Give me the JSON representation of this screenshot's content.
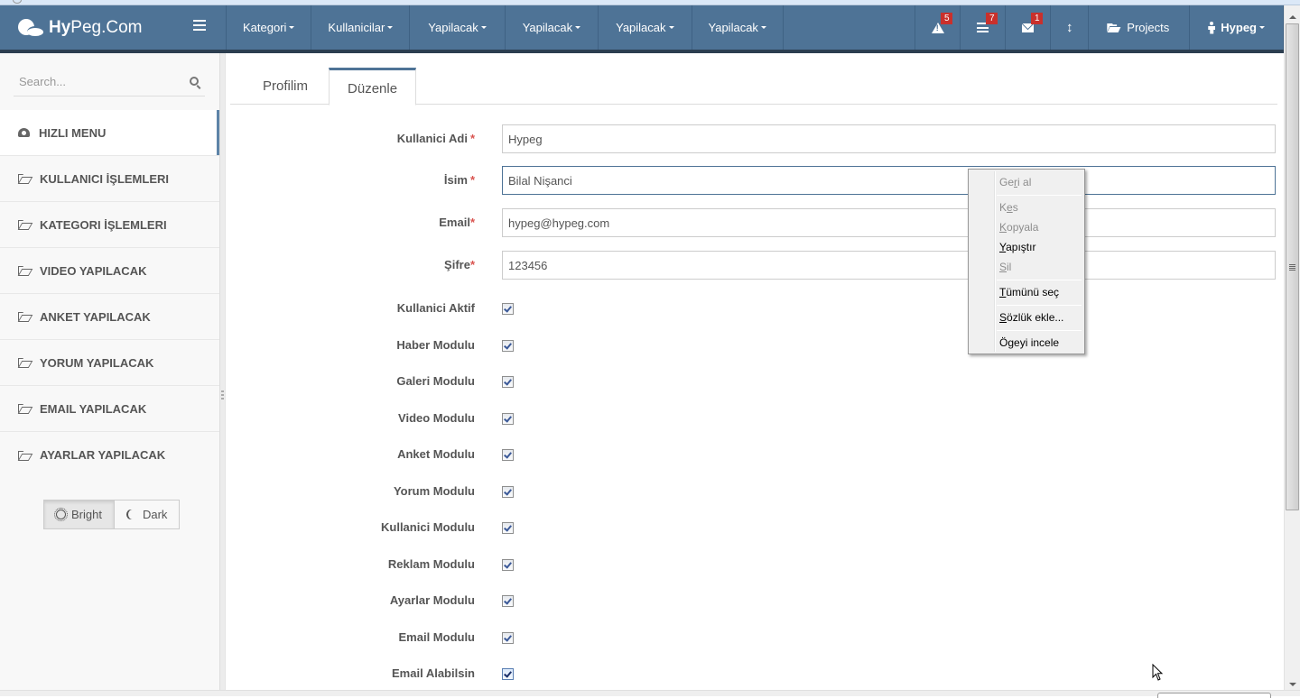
{
  "navbar": {
    "brand_bold": "Hy",
    "brand_rest": "Peg.Com",
    "menus": [
      {
        "label": "Kategori"
      },
      {
        "label": "Kullanicilar"
      },
      {
        "label": "Yapilacak"
      },
      {
        "label": "Yapilacak"
      },
      {
        "label": "Yapilacak"
      },
      {
        "label": "Yapilacak"
      }
    ],
    "alerts_badge": "5",
    "tasks_badge": "7",
    "messages_badge": "1",
    "projects_label": "Projects",
    "user_label": "Hypeg",
    "accent_color": "#4e7396",
    "badge_color": "#c9302c"
  },
  "sidebar": {
    "search_placeholder": "Search...",
    "items": [
      {
        "label": "HIZLI MENU",
        "icon": "dashboard-icon",
        "active": true
      },
      {
        "label": "KULLANICI İŞLEMLERI",
        "icon": "folder-open-icon"
      },
      {
        "label": "KATEGORI İŞLEMLERI",
        "icon": "folder-open-icon"
      },
      {
        "label": "VIDEO YAPILACAK",
        "icon": "folder-open-icon"
      },
      {
        "label": "ANKET YAPILACAK",
        "icon": "folder-open-icon"
      },
      {
        "label": "YORUM YAPILACAK",
        "icon": "folder-open-icon"
      },
      {
        "label": "EMAIL YAPILACAK",
        "icon": "folder-open-icon"
      },
      {
        "label": "AYARLAR YAPILACAK",
        "icon": "folder-open-icon"
      }
    ],
    "theme": {
      "bright_label": "Bright",
      "dark_label": "Dark",
      "selected": "Bright"
    }
  },
  "main": {
    "tabs": [
      {
        "label": "Profilim",
        "active": false
      },
      {
        "label": "Düzenle",
        "active": true
      }
    ],
    "form": {
      "fields": [
        {
          "label": "Kullanici Adi",
          "required_mark": "*",
          "value": "Hypeg"
        },
        {
          "label": "İsim",
          "required_mark": "*",
          "value": "Bilal Nişanci",
          "focused": true
        },
        {
          "label": "Email",
          "required_mark": "*",
          "value": "hypeg@hypeg.com"
        },
        {
          "label": "Şifre",
          "required_mark": "*",
          "value": "123456"
        }
      ],
      "checkboxes": [
        {
          "label": "Kullanici Aktif",
          "checked": true
        },
        {
          "label": "Haber Modulu",
          "checked": true
        },
        {
          "label": "Galeri Modulu",
          "checked": true
        },
        {
          "label": "Video Modulu",
          "checked": true
        },
        {
          "label": "Anket Modulu",
          "checked": true
        },
        {
          "label": "Yorum Modulu",
          "checked": true
        },
        {
          "label": "Kullanici Modulu",
          "checked": true
        },
        {
          "label": "Reklam Modulu",
          "checked": true
        },
        {
          "label": "Ayarlar Modulu",
          "checked": true
        },
        {
          "label": "Email Modulu",
          "checked": true
        },
        {
          "label": "Email Alabilsin",
          "checked": true
        }
      ]
    }
  },
  "context_menu": {
    "items": [
      {
        "pre": "Ge",
        "key": "r",
        "post": "i al",
        "enabled": false
      },
      {
        "pre": "K",
        "key": "e",
        "post": "s",
        "enabled": false
      },
      {
        "pre": "",
        "key": "K",
        "post": "opyala",
        "enabled": false
      },
      {
        "pre": "",
        "key": "Y",
        "post": "apıştır",
        "enabled": true
      },
      {
        "pre": "",
        "key": "S",
        "post": "il",
        "enabled": false
      },
      {
        "pre": "",
        "key": "T",
        "post": "ümünü seç",
        "enabled": true
      },
      {
        "pre": "",
        "key": "S",
        "post": "özlük ekle...",
        "enabled": true
      },
      {
        "pre": "Ö",
        "key": "g",
        "post": "eyi incele",
        "enabled": true
      }
    ]
  }
}
